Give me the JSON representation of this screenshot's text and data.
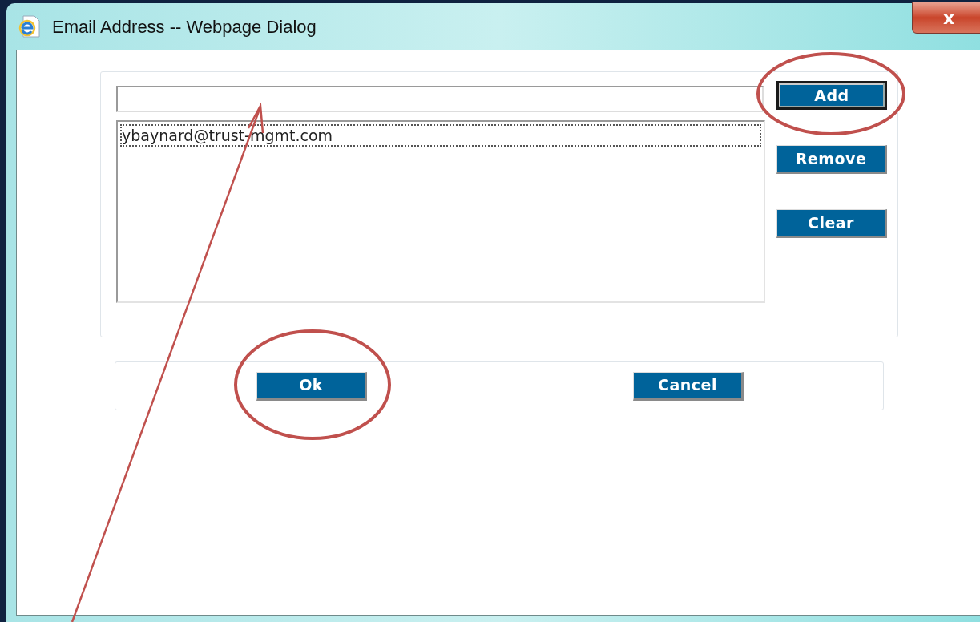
{
  "window": {
    "title": "Email Address -- Webpage Dialog",
    "close_label": "x"
  },
  "address_list": [
    {
      "text": "ybaynard@trust-mgmt.com",
      "focused": true
    }
  ],
  "side_buttons": [
    {
      "label": "Add",
      "default": true
    },
    {
      "label": "Remove",
      "default": false
    },
    {
      "label": "Clear",
      "default": false
    }
  ],
  "footer_buttons": [
    {
      "label": "Ok",
      "default": false
    },
    {
      "label": "Cancel",
      "default": false
    }
  ]
}
